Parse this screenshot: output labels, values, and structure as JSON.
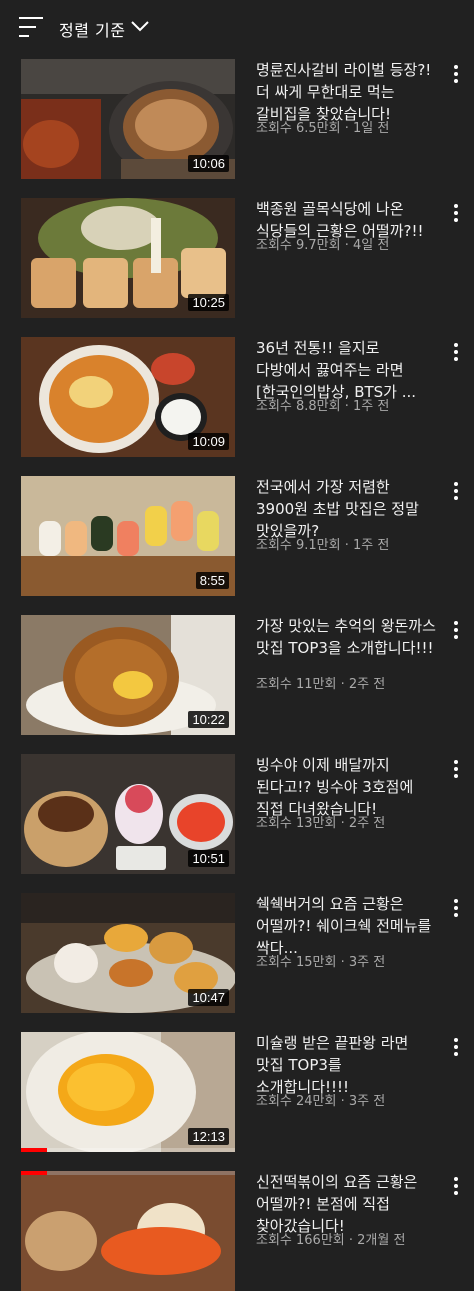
{
  "sort": {
    "label": "정렬 기준"
  },
  "videos": [
    {
      "title": "명륜진사갈비 라이벌 등장?! 더 싸게 무한대로 먹는 갈비집을 찾았습니다!",
      "views": "조회수 6.5만회",
      "age": "1일 전",
      "duration": "10:06"
    },
    {
      "title": "백종원 골목식당에 나온 식당들의 근황은 어떨까?!!",
      "views": "조회수 9.7만회",
      "age": "4일 전",
      "duration": "10:25"
    },
    {
      "title": "36년 전통!! 을지로 다방에서 끓여주는 라면 [한국인의밥상, BTS가 ...",
      "views": "조회수 8.8만회",
      "age": "1주 전",
      "duration": "10:09"
    },
    {
      "title": "전국에서 가장 저렴한 3900원 초밥 맛집은 정말 맛있을까?",
      "views": "조회수 9.1만회",
      "age": "1주 전",
      "duration": "8:55"
    },
    {
      "title": "가장 맛있는 추억의 왕돈까스 맛집 TOP3을 소개합니다!!!",
      "views": "조회수 11만회",
      "age": "2주 전",
      "duration": "10:22"
    },
    {
      "title": "빙수야 이제 배달까지 된다고!? 빙수야 3호점에 직접 다녀왔습니다!",
      "views": "조회수 13만회",
      "age": "2주 전",
      "duration": "10:51"
    },
    {
      "title": "쉑쉑버거의 요즘 근황은 어떨까?! 쉐이크쉑 전메뉴를 싹다...",
      "views": "조회수 15만회",
      "age": "3주 전",
      "duration": "10:47"
    },
    {
      "title": "미슐랭 받은 끝판왕 라면 맛집 TOP3를 소개합니다!!!!",
      "views": "조회수 24만회",
      "age": "3주 전",
      "duration": "12:13",
      "watched": 0.12
    },
    {
      "title": "신전떡볶이의 요즘 근황은 어떨까?! 본점에 직접 찾아갔습니다!",
      "views": "조회수 166만회",
      "age": "2개월 전",
      "duration": "",
      "watched": 0.12
    }
  ]
}
